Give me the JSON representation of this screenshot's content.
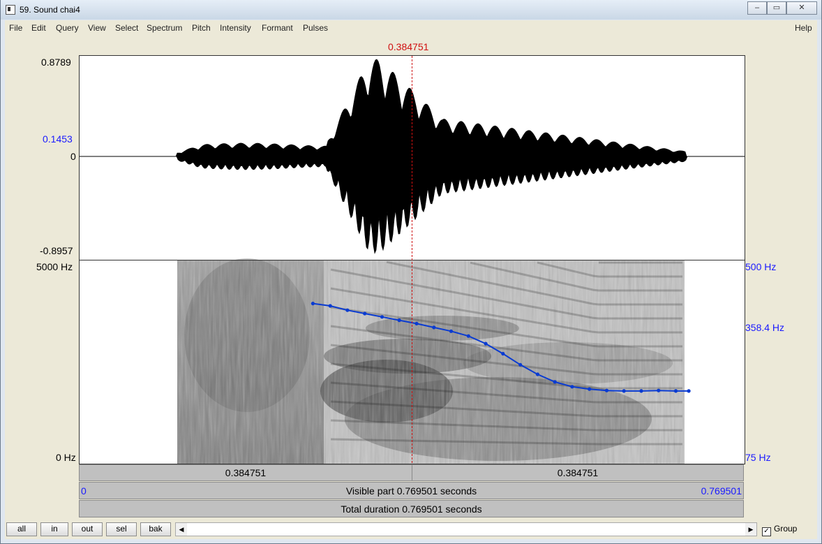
{
  "window": {
    "title": "59. Sound chai4",
    "controls": [
      "–",
      "▭",
      "✕"
    ]
  },
  "menu": {
    "items": [
      "File",
      "Edit",
      "Query",
      "View",
      "Select",
      "Spectrum",
      "Pitch",
      "Intensity",
      "Formant",
      "Pulses"
    ],
    "help": "Help"
  },
  "cursor": {
    "time_label": "0.384751",
    "time": 0.384751
  },
  "waveform": {
    "max_label": "0.8789",
    "mark_label": "0.1453",
    "zero_label": "0",
    "min_label": "-0.8957"
  },
  "spectrogram": {
    "top_label": "5000 Hz",
    "bottom_label": "0 Hz"
  },
  "pitch": {
    "top_label": "500 Hz",
    "mark_label": "358.4 Hz",
    "bottom_label": "75 Hz",
    "range_hz": [
      75,
      500
    ],
    "color": "#0a3bd1",
    "contour_time": [
      0.27,
      0.29,
      0.31,
      0.33,
      0.35,
      0.37,
      0.39,
      0.41,
      0.43,
      0.45,
      0.47,
      0.49,
      0.51,
      0.53,
      0.55,
      0.57,
      0.59,
      0.61,
      0.63,
      0.65,
      0.67,
      0.69,
      0.705
    ],
    "contour_hz": [
      410,
      405,
      396,
      389,
      382,
      375,
      368,
      360,
      352,
      342,
      326,
      305,
      282,
      262,
      246,
      236,
      231,
      228,
      227,
      227,
      228,
      227,
      227
    ]
  },
  "time_axis": {
    "start": 0,
    "end": 0.769501
  },
  "bars": {
    "left_part": "0.384751",
    "right_part": "0.384751",
    "visible_text": "Visible part 0.769501 seconds",
    "visible_start": "0",
    "visible_end": "0.769501",
    "total_text": "Total duration 0.769501 seconds"
  },
  "bottom": {
    "buttons": [
      "all",
      "in",
      "out",
      "sel",
      "bak"
    ],
    "scroll_left": "◀",
    "scroll_right": "▶",
    "group_label": "Group",
    "group_checked": true
  }
}
